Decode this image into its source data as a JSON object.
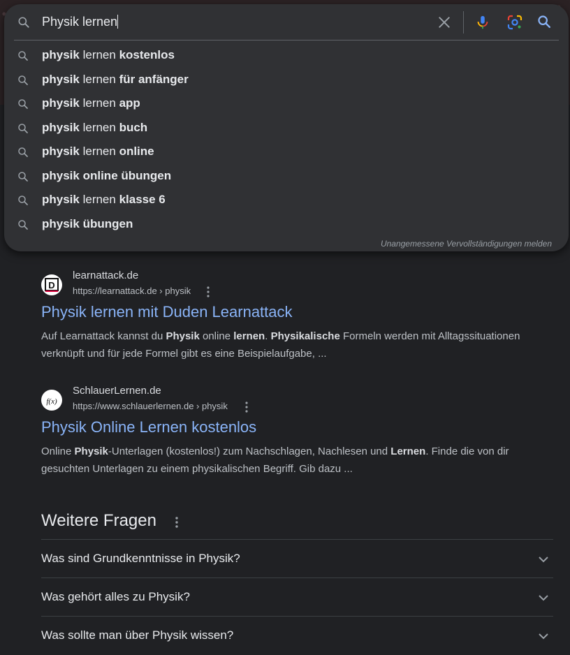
{
  "search": {
    "query": "Physik lernen",
    "suggestions": [
      {
        "pre": "physik",
        "mid": " lernen ",
        "post": "kostenlos"
      },
      {
        "pre": "physik",
        "mid": " lernen ",
        "post": "für anfänger"
      },
      {
        "pre": "physik",
        "mid": " lernen ",
        "post": "app"
      },
      {
        "pre": "physik",
        "mid": " lernen ",
        "post": "buch"
      },
      {
        "pre": "physik",
        "mid": " lernen ",
        "post": "online"
      },
      {
        "pre": "physik",
        "mid": " ",
        "post": "online übungen"
      },
      {
        "pre": "physik",
        "mid": " lernen ",
        "post": "klasse 6"
      },
      {
        "pre": "physik",
        "mid": " ",
        "post": "übungen"
      }
    ],
    "report_link": "Unangemessene Vervollständigungen melden"
  },
  "results": [
    {
      "site": "learnattack.de",
      "url": "https://learnattack.de › physik",
      "title": "Physik lernen mit Duden Learnattack",
      "snippet_parts": [
        {
          "t": "Auf Learnattack kannst du ",
          "b": false
        },
        {
          "t": "Physik",
          "b": true
        },
        {
          "t": " online ",
          "b": false
        },
        {
          "t": "lernen",
          "b": true
        },
        {
          "t": ". ",
          "b": false
        },
        {
          "t": "Physikalische",
          "b": true
        },
        {
          "t": " Formeln werden mit Alltagssituationen verknüpft und für jede Formel gibt es eine Beispielaufgabe, ...",
          "b": false
        }
      ],
      "favicon_letter": "D"
    },
    {
      "site": "SchlauerLernen.de",
      "url": "https://www.schlauerlernen.de › physik",
      "title": "Physik Online Lernen kostenlos",
      "snippet_parts": [
        {
          "t": "Online ",
          "b": false
        },
        {
          "t": "Physik",
          "b": true
        },
        {
          "t": "-Unterlagen (kostenlos!) zum Nachschlagen, Nachlesen und ",
          "b": false
        },
        {
          "t": "Lernen",
          "b": true
        },
        {
          "t": ". Finde die von dir gesuchten Unterlagen zu einem physikalischen Begriff. Gib dazu ...",
          "b": false
        }
      ],
      "favicon_letter": "f(x)"
    }
  ],
  "faq": {
    "heading": "Weitere Fragen",
    "questions": [
      "Was sind Grundkenntnisse in Physik?",
      "Was gehört alles zu Physik?",
      "Was sollte man über Physik wissen?"
    ]
  },
  "colors": {
    "background": "#202124",
    "dropdown": "#303134",
    "link": "#8ab4f8",
    "text": "#e8eaed",
    "muted": "#bdc1c6"
  }
}
